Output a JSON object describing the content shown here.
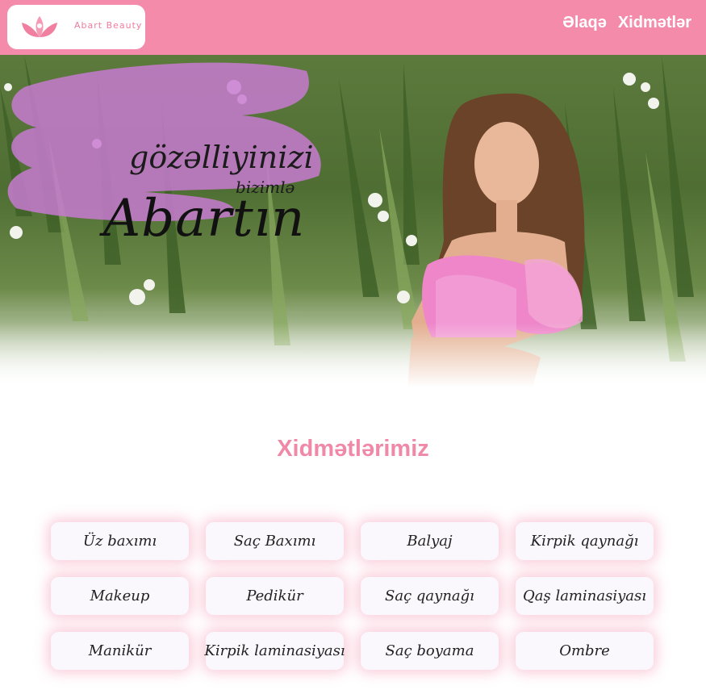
{
  "header": {
    "brand": "Abart Beauty",
    "nav": [
      "Əlaqə",
      "Xidmətlər"
    ],
    "bg_color": "#f48bab"
  },
  "hero": {
    "line1": "gözəlliyinizi",
    "line2": "bizimlə",
    "line3": "Abartın"
  },
  "services": {
    "title": "Xidmətlərimiz",
    "items": [
      "Üz baxımı",
      "Saç Baxımı",
      "Balyaj",
      "Kirpik qaynağı",
      "Makeup",
      "Pedikür",
      "Saç qaynağı",
      "Qaş laminasiyası",
      "Manikür",
      "Kirpik laminasiyası",
      "Saç boyama",
      "Ombre"
    ]
  }
}
